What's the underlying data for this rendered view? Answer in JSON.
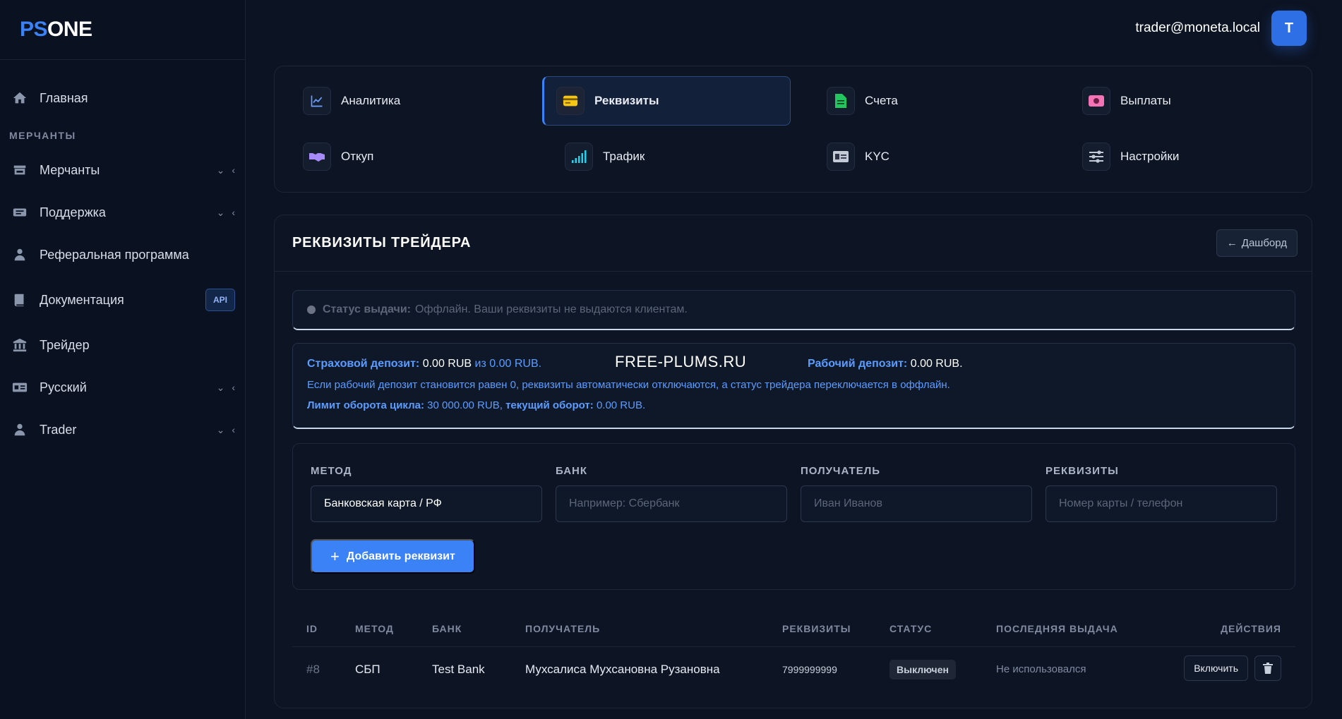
{
  "brand": {
    "part1": "PS",
    "part2": "ONE"
  },
  "header": {
    "email": "trader@moneta.local",
    "avatar_letter": "T"
  },
  "sidebar": {
    "home": "Главная",
    "section_merchants": "МЕРЧАНТЫ",
    "merchants": "Мерчанты",
    "support": "Поддержка",
    "referral": "Реферальная программа",
    "docs": "Документация",
    "docs_badge": "API",
    "trader": "Трейдер",
    "language": "Русский",
    "user": "Trader"
  },
  "tabs": {
    "analytics": "Аналитика",
    "requisites": "Реквизиты",
    "accounts": "Счета",
    "payouts": "Выплаты",
    "buyback": "Откуп",
    "traffic": "Трафик",
    "kyc": "KYC",
    "settings": "Настройки"
  },
  "card": {
    "title": "РЕКВИЗИТЫ ТРЕЙДЕРА",
    "back_button": "Дашборд"
  },
  "status": {
    "label": "Статус выдачи:",
    "text": "Оффлайн. Ваши реквизиты не выдаются клиентам."
  },
  "deposit": {
    "insurance_label": "Страховой депозит:",
    "insurance_value": "0.00 RUB",
    "insurance_of": "из 0.00 RUB.",
    "watermark": "FREE-PLUMS.RU",
    "working_label": "Рабочий депозит:",
    "working_value": "0.00 RUB.",
    "note": "Если рабочий депозит становится равен 0, реквизиты автоматически отключаются, а статус трейдера переключается в оффлайн.",
    "limit_label": "Лимит оборота цикла:",
    "limit_value": "30 000.00 RUB,",
    "turnover_label": "текущий оборот:",
    "turnover_value": "0.00 RUB."
  },
  "form": {
    "method_label": "МЕТОД",
    "method_value": "Банковская карта / РФ",
    "bank_label": "БАНК",
    "bank_placeholder": "Например: Сбербанк",
    "recipient_label": "ПОЛУЧАТЕЛЬ",
    "recipient_placeholder": "Иван Иванов",
    "requisites_label": "РЕКВИЗИТЫ",
    "requisites_placeholder": "Номер карты / телефон",
    "add_button": "Добавить реквизит"
  },
  "table": {
    "columns": [
      "ID",
      "МЕТОД",
      "БАНК",
      "ПОЛУЧАТЕЛЬ",
      "РЕКВИЗИТЫ",
      "СТАТУС",
      "ПОСЛЕДНЯЯ ВЫДАЧА",
      "ДЕЙСТВИЯ"
    ],
    "rows": [
      {
        "id": "#8",
        "method": "СБП",
        "bank": "Test Bank",
        "recipient": "Мухсалиса Мухсановна Рузановна",
        "requisites": "7999999999",
        "status": "Выключен",
        "last_issue": "Не использовался",
        "enable_button": "Включить"
      }
    ]
  },
  "colors": {
    "accent": "#3b82f6",
    "info": "#5b9cff",
    "background": "#0c1322"
  }
}
